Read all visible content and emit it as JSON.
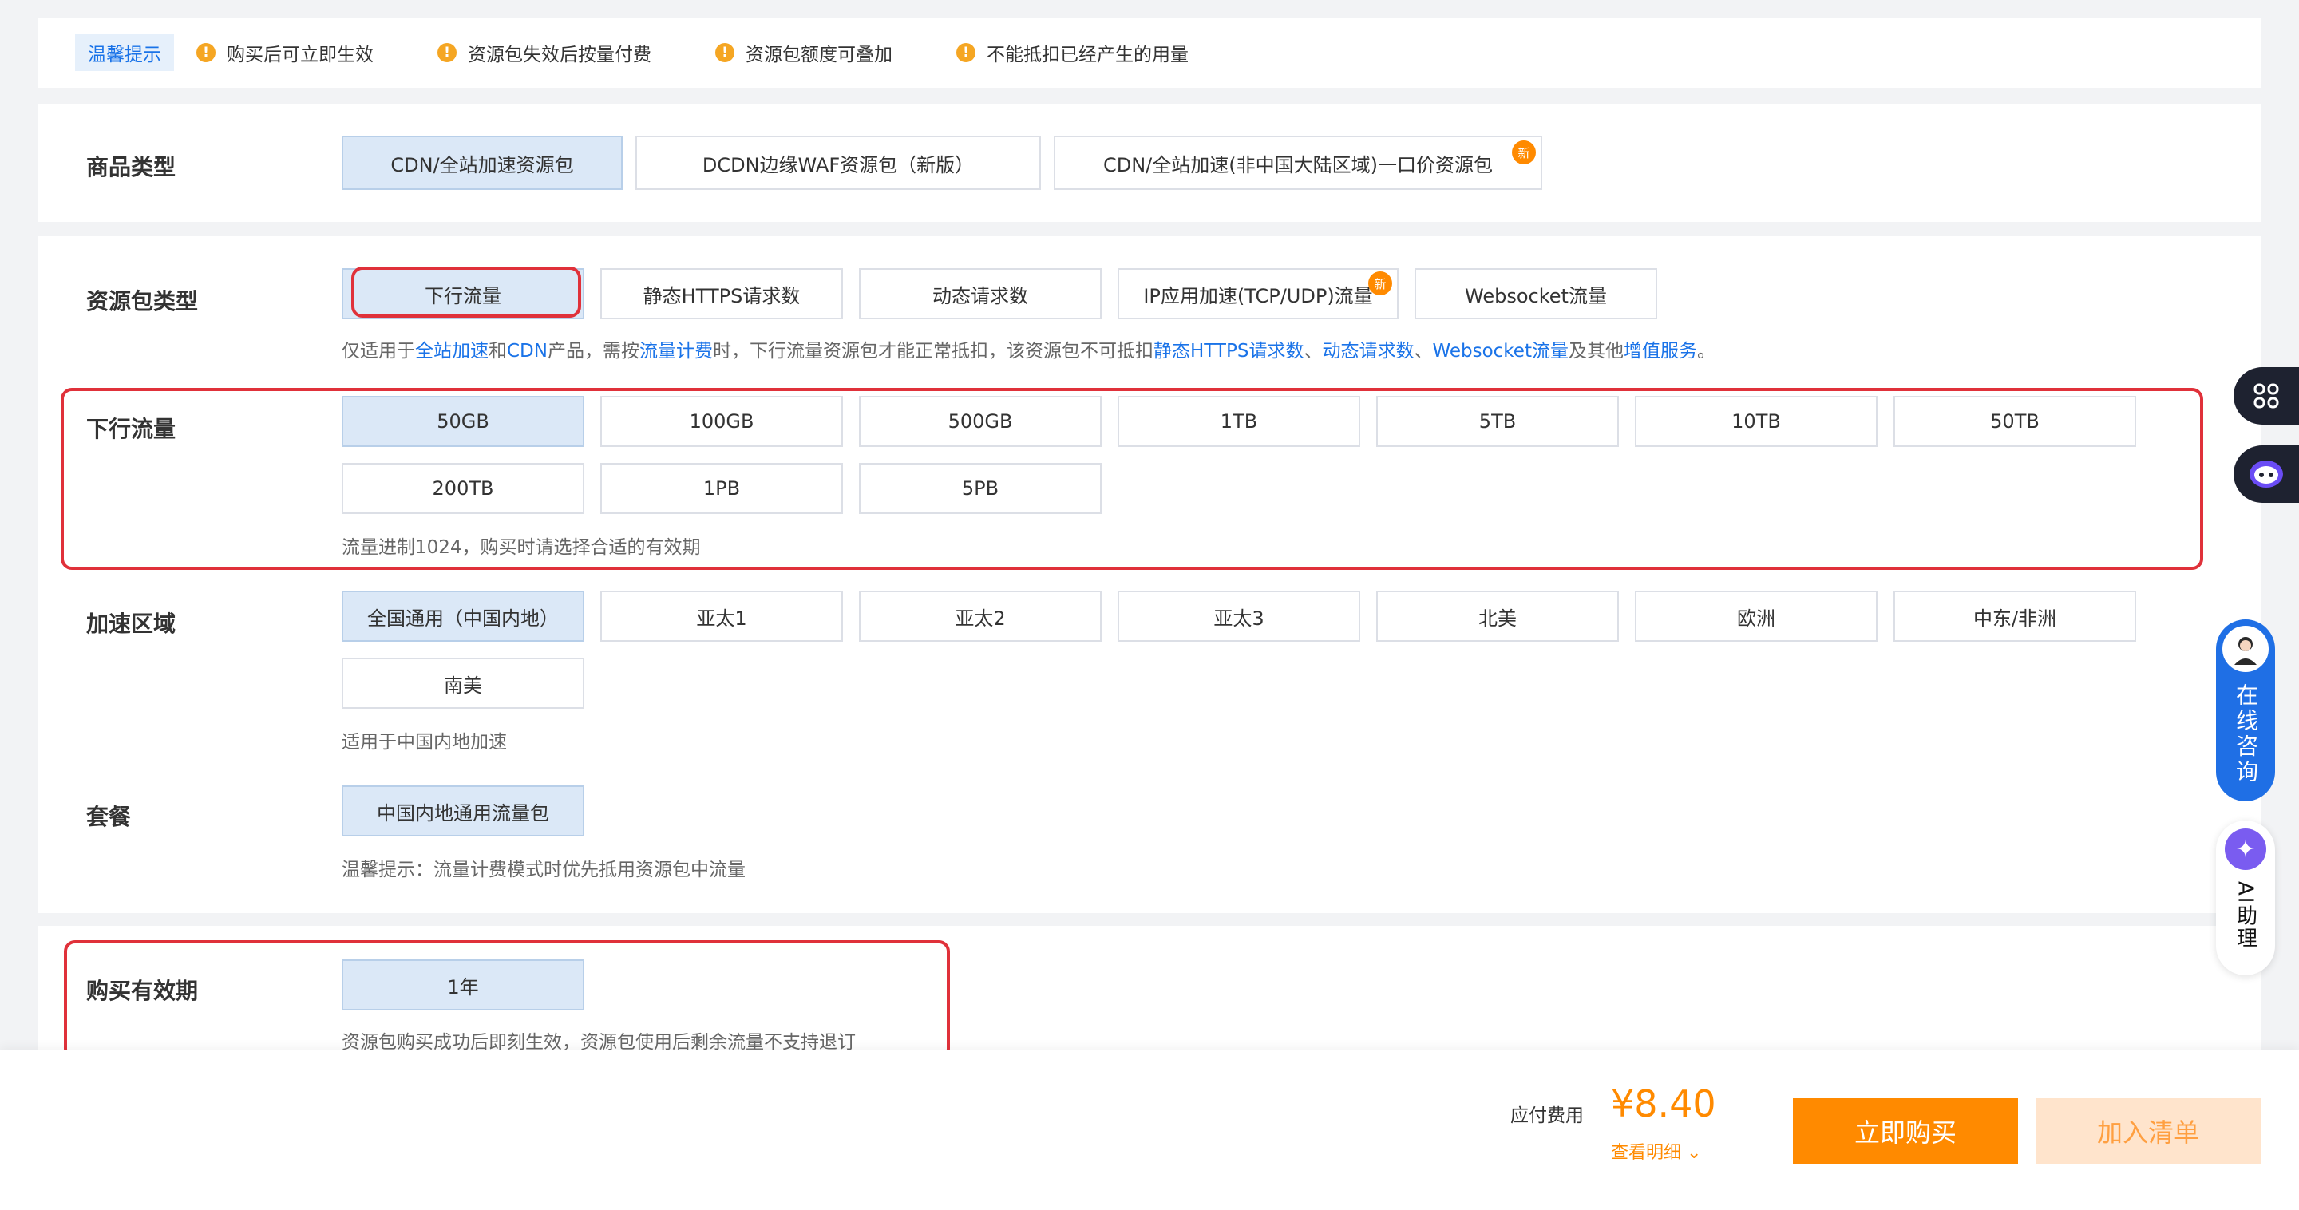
{
  "tips": {
    "badge": "温馨提示",
    "items": [
      "购买后可立即生效",
      "资源包失效后按量付费",
      "资源包额度可叠加",
      "不能抵扣已经产生的用量"
    ]
  },
  "product_type": {
    "label": "商品类型",
    "options": [
      "CDN/全站加速资源包",
      "DCDN边缘WAF资源包（新版）",
      "CDN/全站加速(非中国大陆区域)一口价资源包"
    ],
    "new_badge": "新"
  },
  "package_type": {
    "label": "资源包类型",
    "options": [
      "下行流量",
      "静态HTTPS请求数",
      "动态请求数",
      "IP应用加速(TCP/UDP)流量",
      "Websocket流量"
    ],
    "new_badge": "新",
    "desc": {
      "t1": "仅适用于",
      "l1": "全站加速",
      "t2": "和",
      "l2": "CDN",
      "t3": "产品，需按",
      "l3": "流量计费",
      "t4": "时，下行流量资源包才能正常抵扣，该资源包不可抵扣",
      "l4": "静态HTTPS请求数",
      "t5": "、",
      "l5": "动态请求数",
      "t6": "、",
      "l6": "Websocket流量",
      "t7": "及其他",
      "l7": "增值服务",
      "t8": "。"
    }
  },
  "traffic": {
    "label": "下行流量",
    "options": [
      "50GB",
      "100GB",
      "500GB",
      "1TB",
      "5TB",
      "10TB",
      "50TB",
      "200TB",
      "1PB",
      "5PB"
    ],
    "desc": "流量进制1024，购买时请选择合适的有效期"
  },
  "region": {
    "label": "加速区域",
    "options": [
      "全国通用（中国内地）",
      "亚太1",
      "亚太2",
      "亚太3",
      "北美",
      "欧洲",
      "中东/非洲",
      "南美"
    ],
    "desc": "适用于中国内地加速"
  },
  "plan": {
    "label": "套餐",
    "options": [
      "中国内地通用流量包"
    ],
    "desc": "温馨提示：流量计费模式时优先抵用资源包中流量"
  },
  "period": {
    "label": "购买有效期",
    "options": [
      "1年"
    ],
    "desc": "资源包购买成功后即刻生效，资源包使用后剩余流量不支持退订"
  },
  "footer": {
    "fee_label": "应付费用",
    "price": "¥8.40",
    "detail": "查看明细",
    "buy": "立即购买",
    "cart": "加入清单"
  },
  "side": {
    "consult": "在线咨询",
    "ai": "AI助理"
  },
  "colors": {
    "accent": "#ff8a00",
    "link": "#1a73e8",
    "highlight": "#e0313a",
    "selected_bg": "#dbe8f7"
  }
}
